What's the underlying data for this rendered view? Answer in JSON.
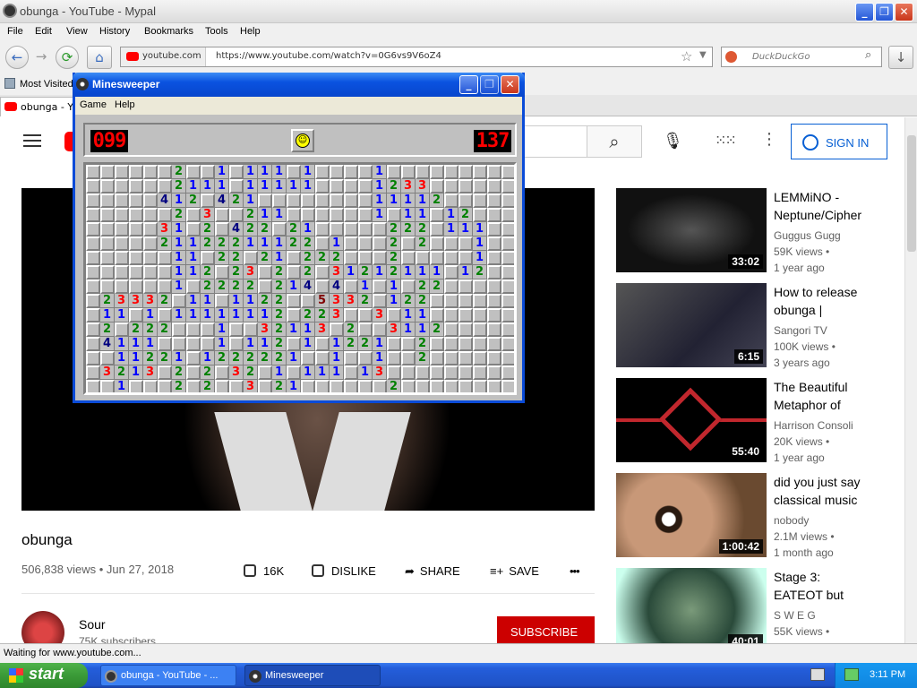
{
  "browser": {
    "window_title": "obunga - YouTube - Mypal",
    "menu": [
      "File",
      "Edit",
      "View",
      "History",
      "Bookmarks",
      "Tools",
      "Help"
    ],
    "url_host": "youtube.com",
    "url": "https://www.youtube.com/watch?v=0G6vs9V6oZ4",
    "search_placeholder": "DuckDuckGo",
    "bookmark": "Most Visited",
    "tab_title": "obunga - Yo",
    "status": "Waiting for www.youtube.com..."
  },
  "youtube": {
    "sign_in": "SIGN IN",
    "video_title": "obunga",
    "views_date": "506,838 views • Jun 27, 2018",
    "likes": "16K",
    "dislike": "DISLIKE",
    "share": "SHARE",
    "save": "SAVE",
    "more": "•••",
    "channel": "Sour",
    "subscribers": "75K subscribers",
    "subscribe": "SUBSCRIBE",
    "recommendations": [
      {
        "title": "LEMMiNO - Neptune/Cipher",
        "channel": "Guggus Gugg",
        "views": "59K views •",
        "age": "1 year ago",
        "duration": "33:02"
      },
      {
        "title": "How to release obunga |",
        "channel": "Sangori TV",
        "views": "100K views •",
        "age": "3 years ago",
        "duration": "6:15"
      },
      {
        "title": "The Beautiful Metaphor of",
        "channel": "Harrison Consoli",
        "views": "20K views •",
        "age": "1 year ago",
        "duration": "55:40"
      },
      {
        "title": "did you just say classical music",
        "channel": "nobody",
        "views": "2.1M views •",
        "age": "1 month ago",
        "duration": "1:00:42"
      },
      {
        "title": "Stage 3: EATEOT but",
        "channel": "S W E G",
        "views": "55K views •",
        "age": "",
        "duration": "40:01"
      }
    ]
  },
  "minesweeper": {
    "title": "Minesweeper",
    "menu": [
      "Game",
      "Help"
    ],
    "mines_left": "099",
    "timer": "137",
    "smiley": "☺",
    "rows": [
      "......2..1.111.1....1.........",
      "......2111.11111....1233......",
      ".....412.421........11112.....",
      "......2.3..211......1.11.12...",
      ".....31.2.422.21.....222.111..",
      ".....21122211122.1...2.2...1..",
      "......11.22.21.222...2.....1..",
      "......112.23.2.2.31212111.12..",
      "......1.2222.214.4.1.1.22.....",
      ".23332.11.1122..5332.122......",
      ".11.1.11111112.223..3.11......",
      ".2.222...1..32113.2..3112.....",
      ".4111....1.112.1.1221..2......",
      "..11221.1222221..1..1..2......",
      ".3213.2.2.32.1.111.13.........",
      "..1...2.2..3.21......2........"
    ]
  },
  "taskbar": {
    "start": "start",
    "items": [
      "obunga - YouTube - ...",
      "Minesweeper"
    ],
    "clock": "3:11 PM"
  }
}
